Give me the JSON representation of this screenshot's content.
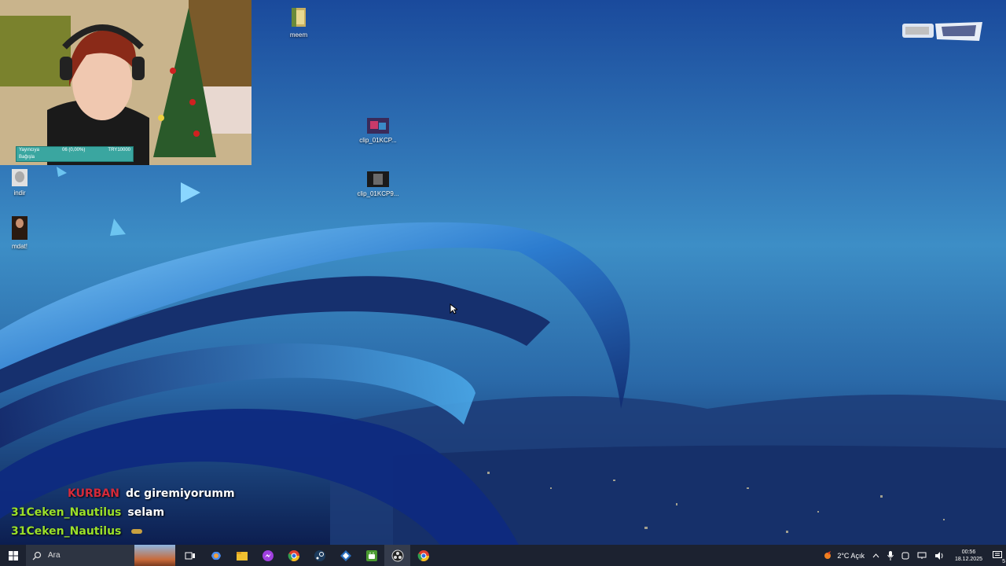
{
  "desktop": {
    "icons": [
      {
        "label": "meem",
        "icon": "folder-icon"
      },
      {
        "label": "clip_01KCP...",
        "icon": "video-thumbnail-icon"
      },
      {
        "label": "clip_01KCP9...",
        "icon": "video-thumbnail-icon"
      },
      {
        "label": "indir",
        "icon": "image-file-icon"
      },
      {
        "label": "mdat!",
        "icon": "image-file-icon"
      }
    ]
  },
  "webcam_overlay": {
    "left_top": "Yayıncıya",
    "left_bottom": "Bağışla",
    "middle": "06 (0,00%)",
    "right": "TRY10000"
  },
  "chat": {
    "lines": [
      {
        "user": "KURBAN",
        "message": "dc giremiyorumm",
        "color": "#d42a3a"
      },
      {
        "user": "31Ceken_Nautilus",
        "message": "selam",
        "color": "#9be02a"
      },
      {
        "user": "31Ceken_Nautilus",
        "message": "",
        "color": "#9be02a"
      }
    ]
  },
  "taskbar": {
    "search_placeholder": "Ara",
    "apps": [
      "task-view-icon",
      "copilot-icon",
      "file-explorer-icon",
      "messenger-icon",
      "chrome-icon",
      "steam-icon",
      "app-icon",
      "android-icon",
      "obs-icon",
      "chrome-icon"
    ],
    "weather": "2°C  Açık",
    "time": "00:56",
    "date": "18.12.2025",
    "notification_count": "5"
  },
  "colors": {
    "taskbar_bg": "#1c2230",
    "chat_user_red": "#d42a3a",
    "chat_user_green": "#9be02a",
    "overlay_teal": "#3aa6a0"
  }
}
